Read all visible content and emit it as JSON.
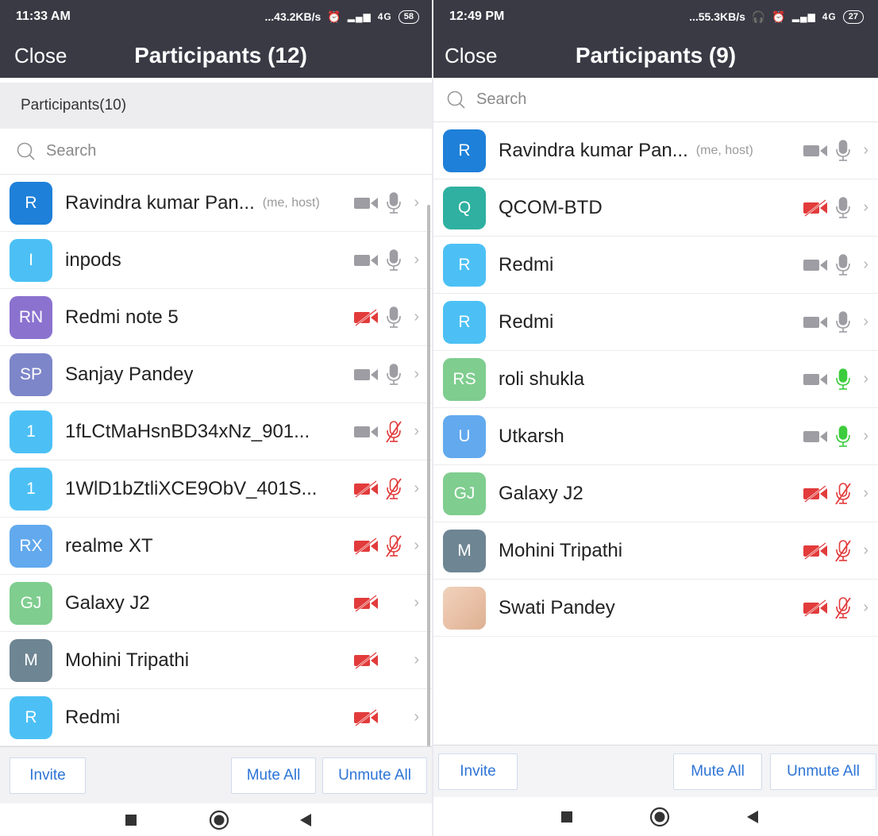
{
  "left": {
    "status": {
      "time": "11:33 AM",
      "speed": "...43.2KB/s",
      "signal_label": "4G",
      "battery": "58"
    },
    "header": {
      "close_label": "Close",
      "title": "Participants (12)"
    },
    "section_title": "Participants(10)",
    "search": {
      "placeholder": "Search"
    },
    "participants": [
      {
        "initials": "R",
        "name": "Ravindra kumar Pan...",
        "tag": "(me, host)",
        "color": "#1e80d8",
        "video": "on",
        "audio": "on"
      },
      {
        "initials": "I",
        "name": "inpods",
        "tag": "",
        "color": "#4cc0f5",
        "video": "on",
        "audio": "on"
      },
      {
        "initials": "RN",
        "name": "Redmi note 5",
        "tag": "",
        "color": "#8b72cf",
        "video": "off",
        "audio": "on"
      },
      {
        "initials": "SP",
        "name": "Sanjay Pandey",
        "tag": "",
        "color": "#7d86c9",
        "video": "on",
        "audio": "on"
      },
      {
        "initials": "1",
        "name": "1fLCtMaHsnBD34xNz_901...",
        "tag": "",
        "color": "#4cc0f5",
        "video": "on",
        "audio": "off"
      },
      {
        "initials": "1",
        "name": "1WlD1bZtliXCE9ObV_401S...",
        "tag": "",
        "color": "#4cc0f5",
        "video": "off",
        "audio": "off"
      },
      {
        "initials": "RX",
        "name": "realme XT",
        "tag": "",
        "color": "#62a9ee",
        "video": "off",
        "audio": "off"
      },
      {
        "initials": "GJ",
        "name": "Galaxy J2",
        "tag": "",
        "color": "#7fcd8f",
        "video": "off",
        "audio": "none"
      },
      {
        "initials": "M",
        "name": "Mohini Tripathi",
        "tag": "",
        "color": "#6e8593",
        "video": "off",
        "audio": "none"
      },
      {
        "initials": "R",
        "name": "Redmi",
        "tag": "",
        "color": "#4cc0f5",
        "video": "off",
        "audio": "none"
      }
    ],
    "footer": {
      "invite_label": "Invite",
      "mute_all_label": "Mute All",
      "unmute_all_label": "Unmute All"
    }
  },
  "right": {
    "status": {
      "time": "12:49 PM",
      "speed": "...55.3KB/s",
      "signal_label": "4G",
      "battery": "27"
    },
    "header": {
      "close_label": "Close",
      "title": "Participants (9)"
    },
    "search": {
      "placeholder": "Search"
    },
    "participants": [
      {
        "initials": "R",
        "name": "Ravindra kumar Pan...",
        "tag": "(me, host)",
        "color": "#1e80d8",
        "video": "on",
        "audio": "on"
      },
      {
        "initials": "Q",
        "name": "QCOM-BTD",
        "tag": "",
        "color": "#2fb0a0",
        "video": "off",
        "audio": "on"
      },
      {
        "initials": "R",
        "name": "Redmi",
        "tag": "",
        "color": "#4cc0f5",
        "video": "on",
        "audio": "on"
      },
      {
        "initials": "R",
        "name": "Redmi",
        "tag": "",
        "color": "#4cc0f5",
        "video": "on",
        "audio": "on"
      },
      {
        "initials": "RS",
        "name": "roli shukla",
        "tag": "",
        "color": "#7fcd8f",
        "video": "on",
        "audio": "active"
      },
      {
        "initials": "U",
        "name": "Utkarsh",
        "tag": "",
        "color": "#62a9ee",
        "video": "on",
        "audio": "active"
      },
      {
        "initials": "GJ",
        "name": "Galaxy J2",
        "tag": "",
        "color": "#7fcd8f",
        "video": "off",
        "audio": "off"
      },
      {
        "initials": "M",
        "name": "Mohini Tripathi",
        "tag": "",
        "color": "#6e8593",
        "video": "off",
        "audio": "off"
      },
      {
        "initials": "",
        "name": "Swati Pandey",
        "tag": "",
        "color": "photo",
        "video": "off",
        "audio": "off"
      }
    ],
    "footer": {
      "invite_label": "Invite",
      "mute_all_label": "Mute All",
      "unmute_all_label": "Unmute All"
    }
  },
  "colors": {
    "header_bg": "#3a3a45",
    "accent": "#2d74d6",
    "muted_red": "#e23b3b",
    "active_green": "#3ccc3c",
    "icon_grey": "#9d9da3"
  },
  "nav": {
    "icons": [
      "recent-apps-icon",
      "home-icon",
      "back-icon"
    ]
  }
}
